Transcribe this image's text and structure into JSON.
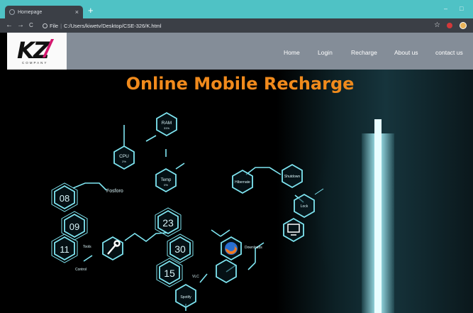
{
  "browser": {
    "tab_title": "Homepage",
    "tab_close": "×",
    "new_tab": "+",
    "back": "←",
    "forward": "→",
    "reload": "C",
    "url_scheme_label": "File",
    "url_separator": "|",
    "url": "C:/Users/kiwetv/Desktop/CSE-326/K.html",
    "star": "☆",
    "minimize": "–",
    "maximize": "□",
    "icons": [
      "globe-icon",
      "info-icon",
      "star-icon",
      "extension-icon",
      "avatar"
    ]
  },
  "header": {
    "logo_text": "KZ",
    "logo_sub": "COMPANY",
    "nav": [
      "Home",
      "Login",
      "Recharge",
      "About us",
      "contact us"
    ]
  },
  "hero": {
    "title": "Online Mobile Recharge",
    "widgets": {
      "ram": "RAM",
      "ram_value": "31%",
      "cpu": "CPU",
      "cpu_value": "2%",
      "temp": "Temp",
      "temp_value": "0%",
      "fosforo": "Fosforo",
      "hibernate": "Hibernate",
      "shutdown": "Shutdown",
      "lock": "Lock",
      "tools": "Tools",
      "control": "Control",
      "downloads": "Downloads",
      "vlc": "VLC",
      "spotify": "Spotify",
      "n08": "08",
      "n09": "09",
      "n11": "11",
      "n23": "23",
      "n30": "30",
      "n15": "15"
    }
  },
  "colors": {
    "chrome_teal": "#4fc2c5",
    "toolbar_dark": "#3b3f46",
    "header_gray": "#848d98",
    "title_orange": "#f08a1c",
    "widget_cyan": "#7fe6f2"
  }
}
